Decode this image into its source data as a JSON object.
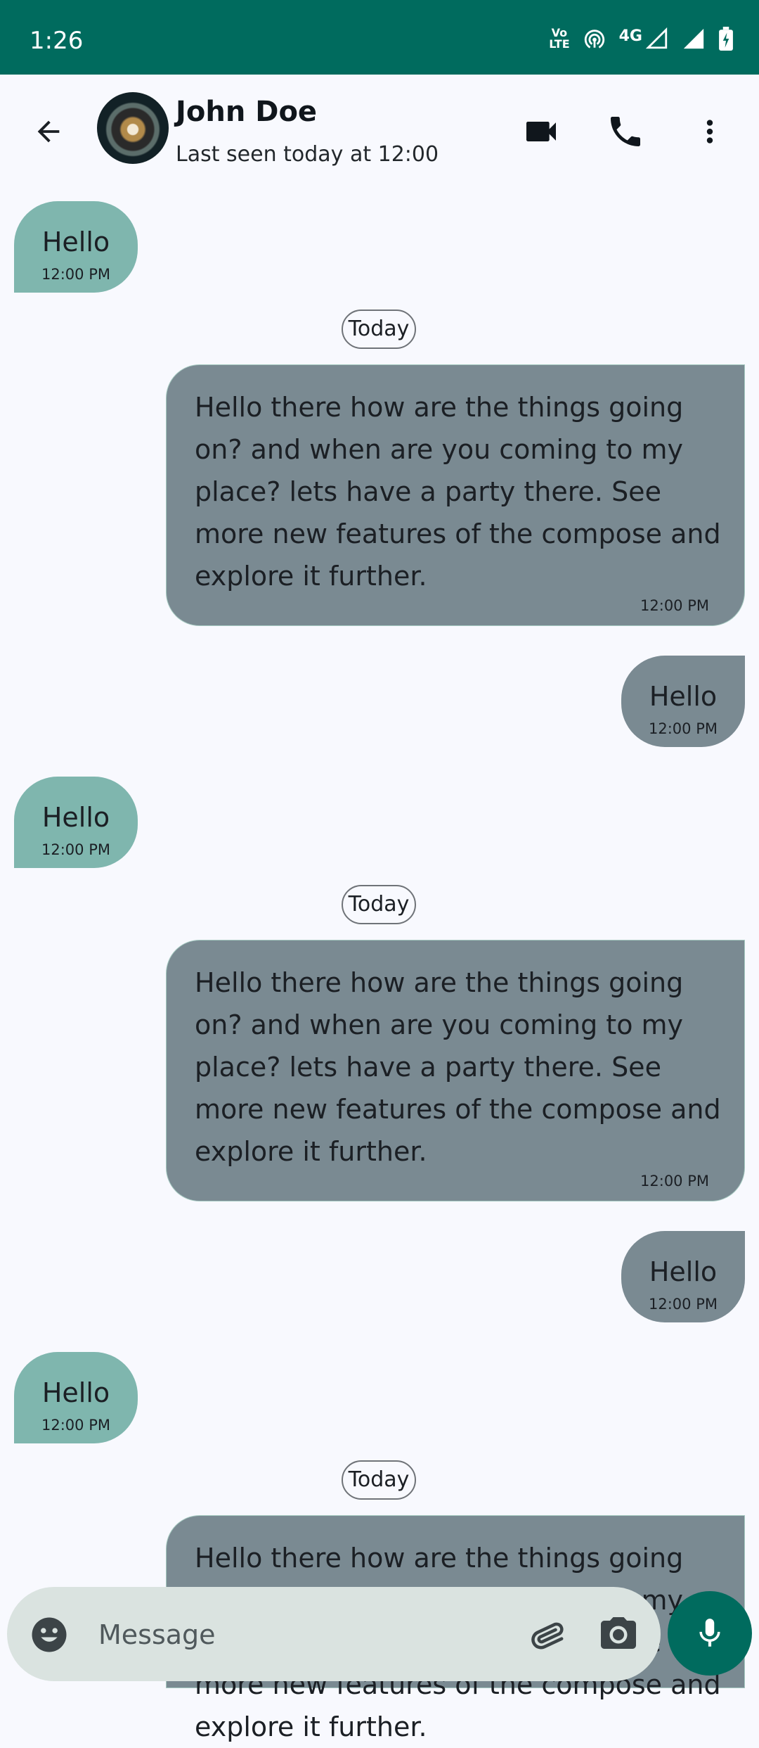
{
  "status_bar": {
    "time": "1:26",
    "volte_top": "Vo",
    "volte_bottom": "LTE",
    "network": "4G"
  },
  "header": {
    "contact_name": "John Doe",
    "last_seen": "Last seen today at 12:00"
  },
  "messages": {
    "short_text": "Hello",
    "long_text": "Hello there how are the things going on? and when are you coming to my place? lets have a party there. See more new features of the compose and explore it further.",
    "time": "12:00 PM",
    "day_label": "Today"
  },
  "composer": {
    "placeholder": "Message"
  },
  "colors": {
    "accent": "#006b5e",
    "incoming_bubble": "#7fb6ae",
    "outgoing_bubble": "#7a8a92",
    "composer_bg": "#dae3e0",
    "background": "#f8f9fe"
  },
  "icons": [
    "arrow-back-icon",
    "videocam-icon",
    "phone-icon",
    "more-vert-icon",
    "emoji-icon",
    "attach-icon",
    "camera-icon",
    "mic-icon",
    "hotspot-icon",
    "signal-icon",
    "battery-icon"
  ]
}
